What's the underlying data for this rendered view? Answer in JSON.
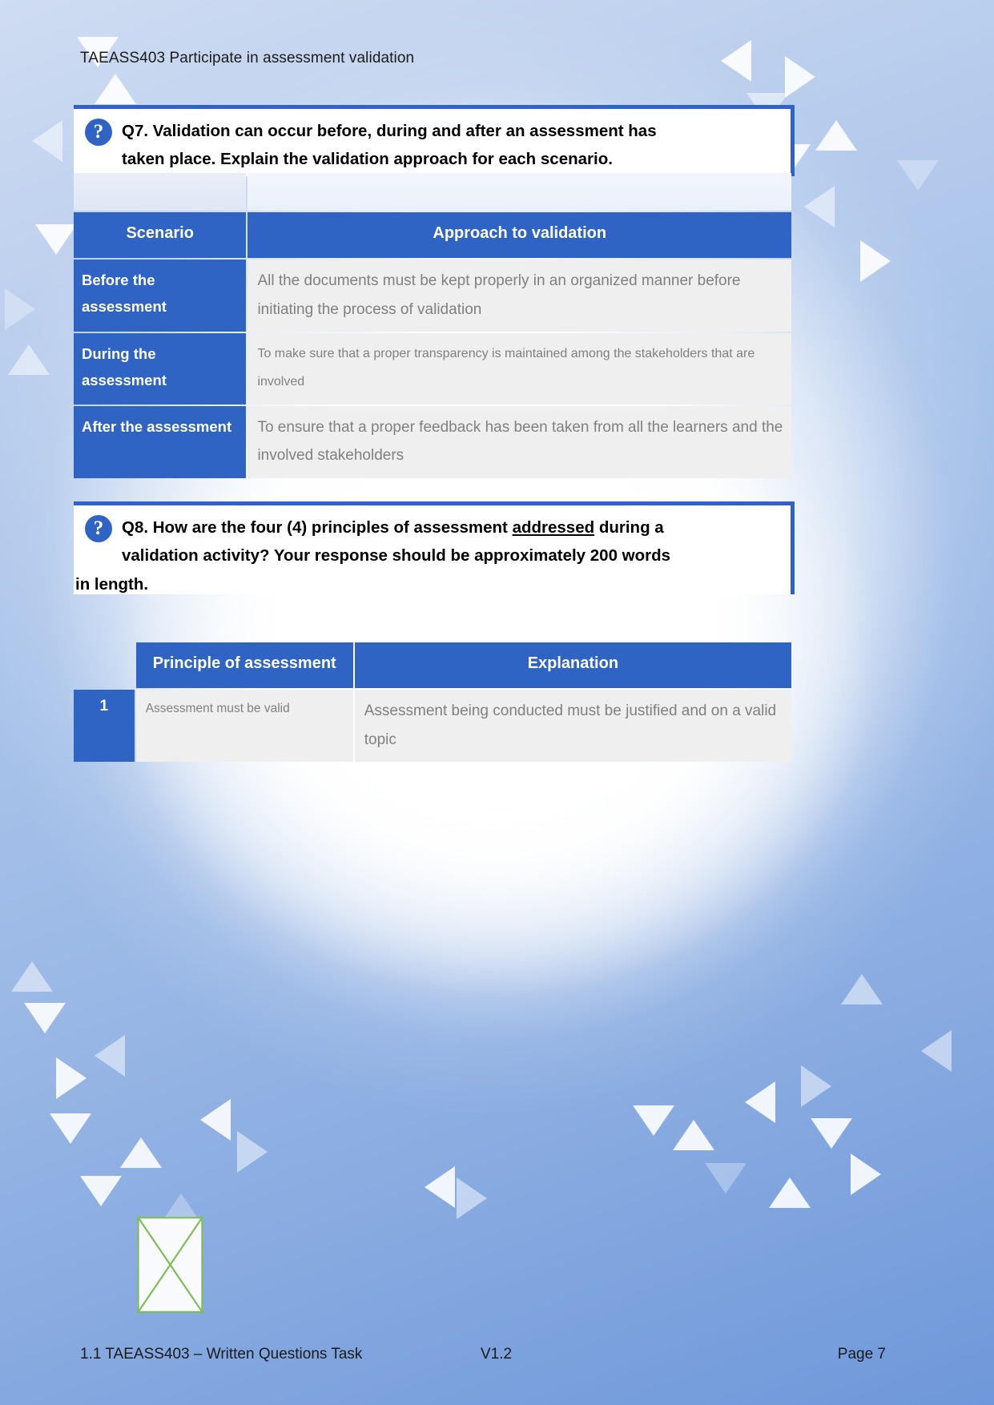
{
  "document": {
    "header_title": "TAEASS403 Participate in assessment validation",
    "icon_glyph": "?",
    "icon_name": "question-mark-icon"
  },
  "questions": [
    {
      "id": "q7",
      "line1": "Q7. Validation can occur before, during and after an assessment has",
      "line2": "taken place. Explain the validation approach for each scenario."
    },
    {
      "id": "q8",
      "line1_a": "Q8. How are the four (4) principles of assessment ",
      "line1_underline": "addressed",
      "line1_b": " during a",
      "line2": "validation activity? Your response should be approximately 200 words",
      "line3": "in length."
    }
  ],
  "table_q7": {
    "headers": {
      "scenario": "Scenario",
      "approach": "Approach to validation"
    },
    "rows": [
      {
        "scenario": "Before the assessment",
        "approach": "All the documents must be kept properly in an organized manner before initiating the process of validation"
      },
      {
        "scenario": "During the assessment",
        "approach": "To make sure that a proper transparency is maintained among the stakeholders that are involved"
      },
      {
        "scenario": "After the assessment",
        "approach": "To ensure that a proper feedback has been taken from all the learners and the involved stakeholders"
      }
    ]
  },
  "table_q8": {
    "headers": {
      "principle": "Principle of assessment",
      "explanation": "Explanation"
    },
    "rows": [
      {
        "number": "1",
        "principle": "Assessment must be valid",
        "explanation": "Assessment being conducted must be justified and on a valid topic"
      }
    ]
  },
  "footer": {
    "left": "1.1 TAEASS403 – Written Questions Task",
    "middle": "V1.2",
    "right": "Page 7"
  },
  "colors": {
    "accent_blue": "#2f63c4",
    "cell_gray": "#efefef",
    "cell_text": "#808080"
  }
}
